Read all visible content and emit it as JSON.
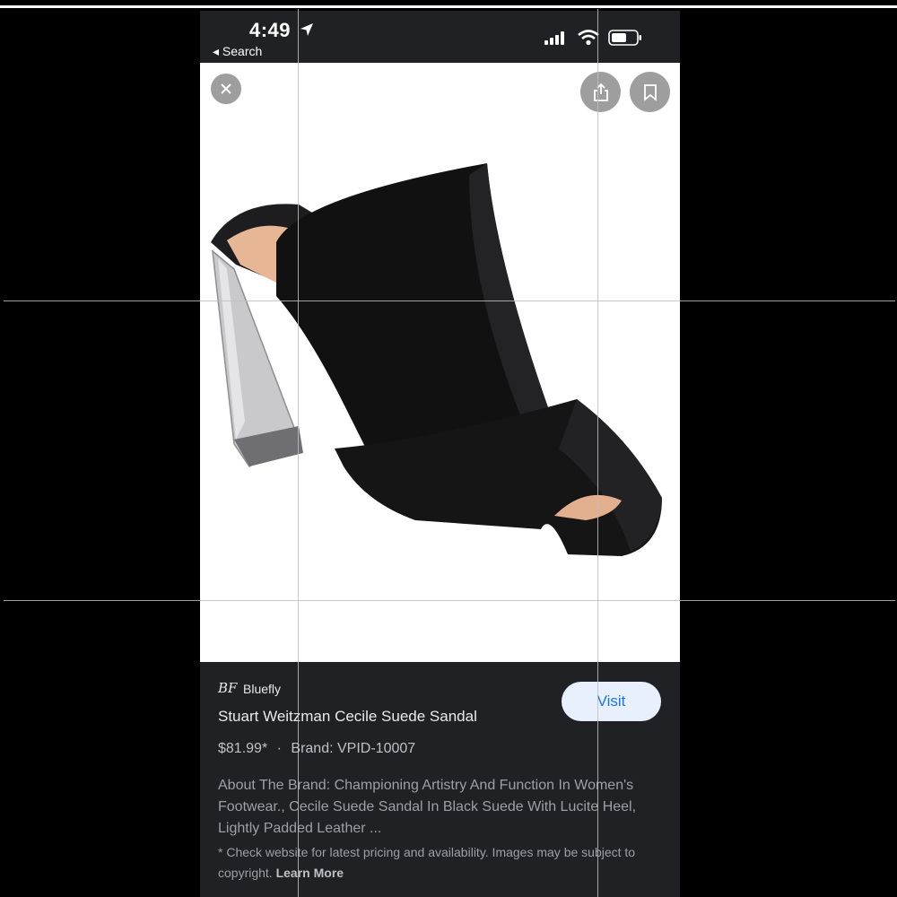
{
  "status_bar": {
    "time": "4:49",
    "back_label": "◂ Search"
  },
  "icons": {
    "location": "location-arrow-icon",
    "signal": "cellular-signal-icon",
    "wifi": "wifi-icon",
    "battery": "battery-icon",
    "close": "close-icon",
    "share": "share-icon",
    "bookmark": "bookmark-icon"
  },
  "product": {
    "image_alt": "Black suede mule sandal with clear lucite block heel",
    "source_logo": "BF",
    "source_name": "Bluefly",
    "title": "Stuart Weitzman Cecile Suede Sandal",
    "visit_label": "Visit",
    "price": "$81.99*",
    "separator": "·",
    "brand": "Brand: VPID-10007",
    "description": "About The Brand: Championing Artistry And Function In Women's Footwear., Cecile Suede Sandal In Black Suede With Lucite Heel, Lightly Padded Leather ...",
    "disclaimer": "* Check website for latest pricing and availability. Images may be subject to copyright.",
    "learn_more": "Learn More"
  },
  "colors": {
    "background": "#000000",
    "panel": "#202124",
    "visit_bg": "#e8f0fe",
    "visit_text": "#1a73e8"
  }
}
